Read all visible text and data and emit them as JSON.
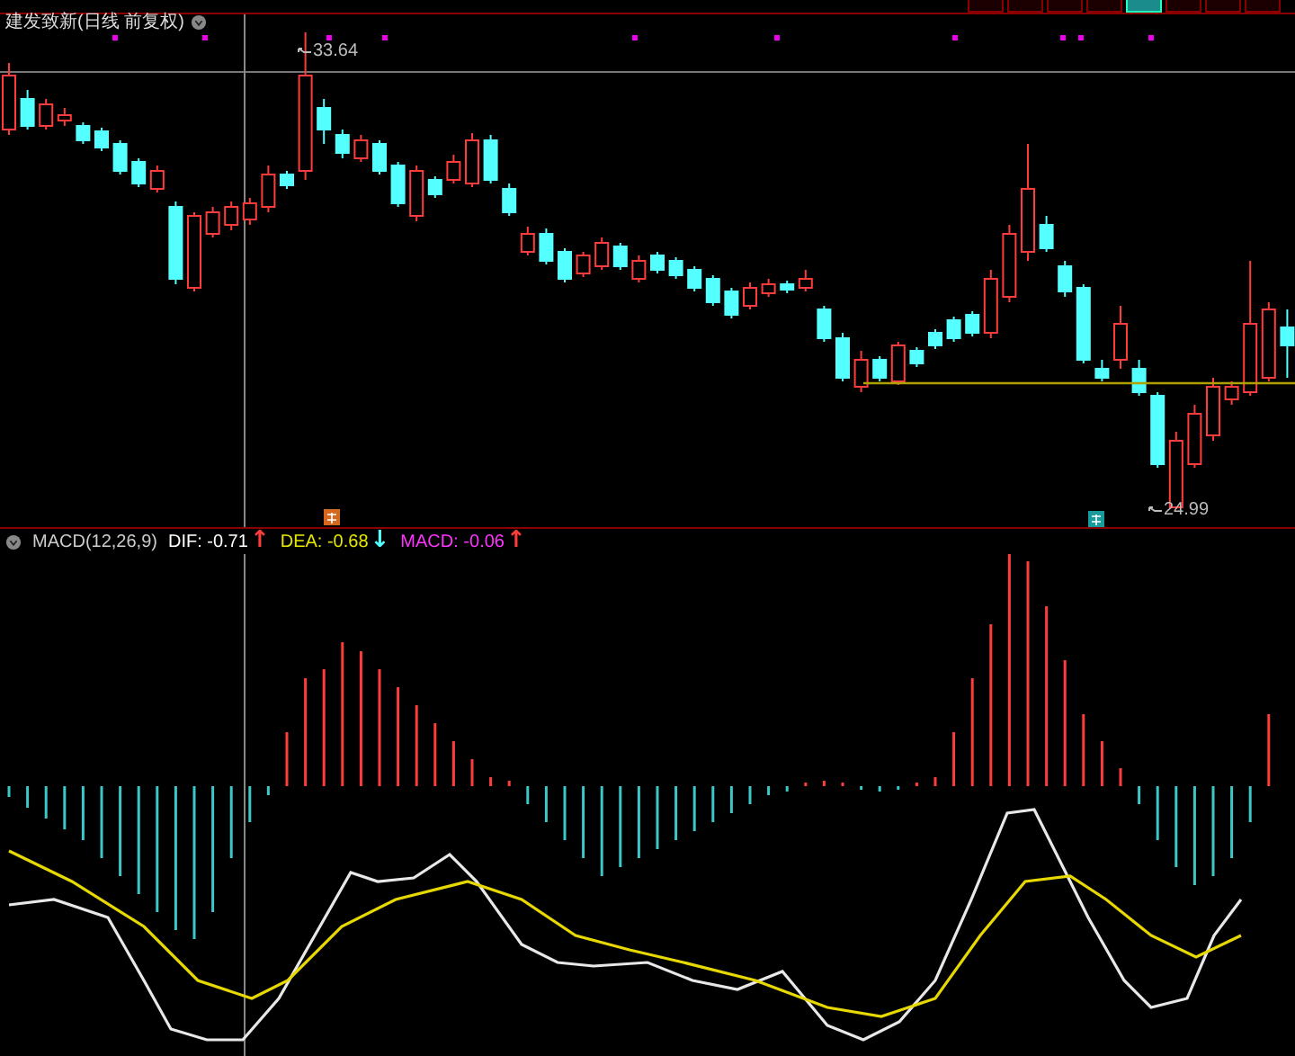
{
  "toolbar": {
    "buttons": [
      {
        "selected": false
      },
      {
        "selected": false
      },
      {
        "selected": false
      },
      {
        "selected": false
      },
      {
        "selected": true
      },
      {
        "selected": false
      },
      {
        "selected": false
      },
      {
        "selected": false
      }
    ]
  },
  "main_chart": {
    "title": "建发致新(日线 前复权)",
    "high_label": "33.64",
    "low_label": "24.99"
  },
  "macd_header": {
    "name": "MACD(12,26,9)",
    "values": [
      {
        "text": "DIF: -0.71",
        "color": "#ffffff",
        "arrow": {
          "text": "↑",
          "color": "#ff3c3c"
        }
      },
      {
        "text": "DEA: -0.68",
        "color": "#e6e600",
        "arrow": {
          "text": "↓",
          "color": "#54ffff"
        }
      },
      {
        "text": "MACD: -0.06",
        "color": "#ff33ff",
        "arrow": {
          "text": "↑",
          "color": "#ff3c3c"
        }
      }
    ]
  }
}
